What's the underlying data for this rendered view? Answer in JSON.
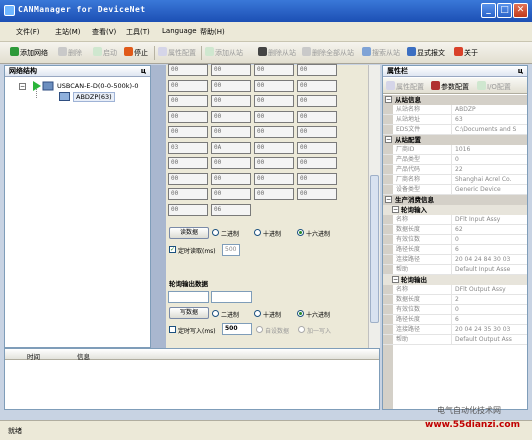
{
  "window": {
    "title": "CANManager for DeviceNet",
    "min": "_",
    "max": "□",
    "close": "✕"
  },
  "menu": [
    "文件(F)",
    "主站(M)",
    "查看(V)",
    "工具(T)",
    "Language",
    "帮助(H)"
  ],
  "toolbar": {
    "add_network": "添加网络",
    "delete": "删除",
    "start": "启动",
    "stop": "停止",
    "attr_config": "属性配置",
    "add_slave": "添加从站",
    "delete_slave": "删除从站",
    "delete_all_slaves": "删除全部从站",
    "scan_slaves": "搜索从站",
    "show_frames": "显式报文",
    "about": "关于"
  },
  "network_panel": {
    "title": "网络结构",
    "pin": "ц",
    "root": "USBCAN-E-D(0-0-500k)-0",
    "child": "ABDZP(63)"
  },
  "io": {
    "input_cells": [
      [
        "00",
        "00",
        "00",
        "00"
      ],
      [
        "00",
        "00",
        "00",
        "00"
      ],
      [
        "00",
        "00",
        "00",
        "00"
      ],
      [
        "00",
        "00",
        "00",
        "00"
      ],
      [
        "00",
        "00",
        "00",
        "00"
      ],
      [
        "03",
        "0A",
        "00",
        "00"
      ],
      [
        "00",
        "00",
        "00",
        "00"
      ],
      [
        "00",
        "00",
        "00",
        "00"
      ],
      [
        "00",
        "00",
        "00",
        "00"
      ],
      [
        "00",
        "06",
        "",
        ""
      ]
    ],
    "read_button": "读数据",
    "binary": "二进制",
    "decimal": "十进制",
    "hex": "十六进制",
    "timed_read": "定时读取(ms)",
    "read_interval": "500",
    "output_title": "轮询输出数据",
    "write_button": "写数据",
    "timed_write": "定时写入(ms)",
    "write_interval": "500",
    "auto_data": "自设数据",
    "add_one": "加一写入"
  },
  "log": {
    "col_time": "时间",
    "col_info": "信息"
  },
  "property_panel": {
    "title": "属性栏",
    "pin": "ц",
    "tab_attr": "属性配置",
    "tab_param": "参数配置",
    "tab_io": "I/O配置",
    "categories": [
      {
        "name": "从站信息",
        "rows": [
          {
            "k": "从站名称",
            "v": "ABDZP"
          },
          {
            "k": "从站地址",
            "v": "63"
          },
          {
            "k": "EDS文件",
            "v": "C:\\Documents and S"
          }
        ]
      },
      {
        "name": "从站配置",
        "rows": [
          {
            "k": "厂商ID",
            "v": "1016"
          },
          {
            "k": "产品类型",
            "v": "0"
          },
          {
            "k": "产品代码",
            "v": "22"
          },
          {
            "k": "厂商名称",
            "v": "Shanghai Acrel Co."
          },
          {
            "k": "设备类型",
            "v": "Generic Device"
          }
        ]
      },
      {
        "name": "生产消费信息",
        "subs": [
          {
            "name": "轮询输入",
            "rows": [
              {
                "k": "名称",
                "v": "DFlt Input Assy"
              },
              {
                "k": "数据长度",
                "v": "62"
              },
              {
                "k": "有效位数",
                "v": "0"
              },
              {
                "k": "路径长度",
                "v": "6"
              },
              {
                "k": "连接路径",
                "v": "20 04 24 84 30 03"
              },
              {
                "k": "帮助",
                "v": "Default Input Asse"
              }
            ]
          },
          {
            "name": "轮询输出",
            "rows": [
              {
                "k": "名称",
                "v": "DFlt Output Assy"
              },
              {
                "k": "数据长度",
                "v": "2"
              },
              {
                "k": "有效位数",
                "v": "0"
              },
              {
                "k": "路径长度",
                "v": "6"
              },
              {
                "k": "连接路径",
                "v": "20 04 24 35 30 03"
              },
              {
                "k": "帮助",
                "v": "Default Output Ass"
              }
            ]
          }
        ]
      }
    ]
  },
  "status": {
    "text": "就绪"
  },
  "watermark": {
    "line1": "电气自动化技术网",
    "line2": "www.55dianzi.com"
  },
  "colors": {
    "title_blue": "#1c4fb4",
    "watermark_red": "#c00000",
    "watermark_gray": "#555555"
  }
}
